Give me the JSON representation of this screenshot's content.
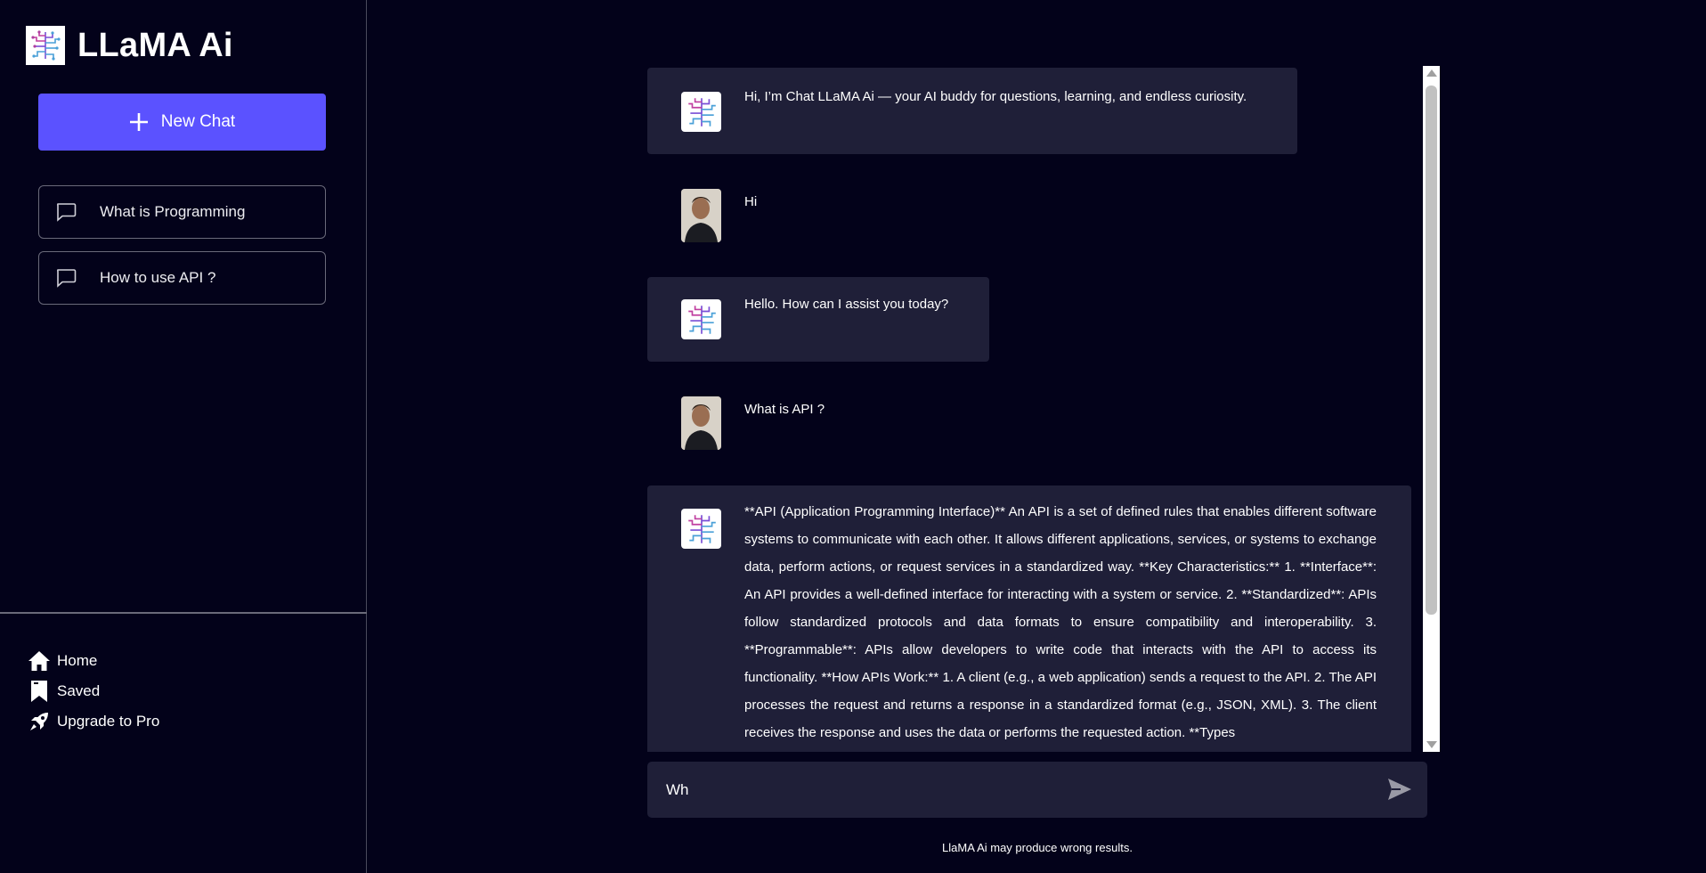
{
  "app": {
    "title": "LLaMA Ai",
    "logo_icon": "circuit-brain-icon"
  },
  "sidebar": {
    "new_chat_label": "New Chat",
    "history": [
      {
        "label": "What is Programming",
        "icon": "chat-bubble-icon"
      },
      {
        "label": "How to use API ?",
        "icon": "chat-bubble-icon"
      }
    ],
    "nav": [
      {
        "label": "Home",
        "icon": "home-icon"
      },
      {
        "label": "Saved",
        "icon": "bookmark-icon"
      },
      {
        "label": "Upgrade to Pro",
        "icon": "rocket-icon"
      }
    ]
  },
  "chat": {
    "messages": [
      {
        "role": "assistant",
        "text": "Hi, I’m Chat LLaMA Ai — your AI buddy for questions, learning, and endless curiosity."
      },
      {
        "role": "user",
        "text": "Hi"
      },
      {
        "role": "assistant",
        "text": "Hello. How can I assist you today?"
      },
      {
        "role": "user",
        "text": "What is API ?"
      },
      {
        "role": "assistant",
        "text": "**API (Application Programming Interface)** An API is a set of defined rules that enables different software systems to communicate with each other. It allows different applications, services, or systems to exchange data, perform actions, or request services in a standardized way. **Key Characteristics:** 1. **Interface**: An API provides a well-defined interface for interacting with a system or service. 2. **Standardized**: APIs follow standardized protocols and data formats to ensure compatibility and interoperability. 3. **Programmable**: APIs allow developers to write code that interacts with the API to access its functionality. **How APIs Work:** 1. A client (e.g., a web application) sends a request to the API. 2. The API processes the request and returns a response in a standardized format (e.g., JSON, XML). 3. The client receives the response and uses the data or performs the requested action. **Types"
      }
    ]
  },
  "input": {
    "value": "Wh",
    "send_icon": "send-icon"
  },
  "footer": {
    "disclaimer": "LlaMA Ai may produce wrong results."
  },
  "colors": {
    "background": "#03021a",
    "accent": "#5b52ff",
    "bubble": "#1f1f38"
  }
}
